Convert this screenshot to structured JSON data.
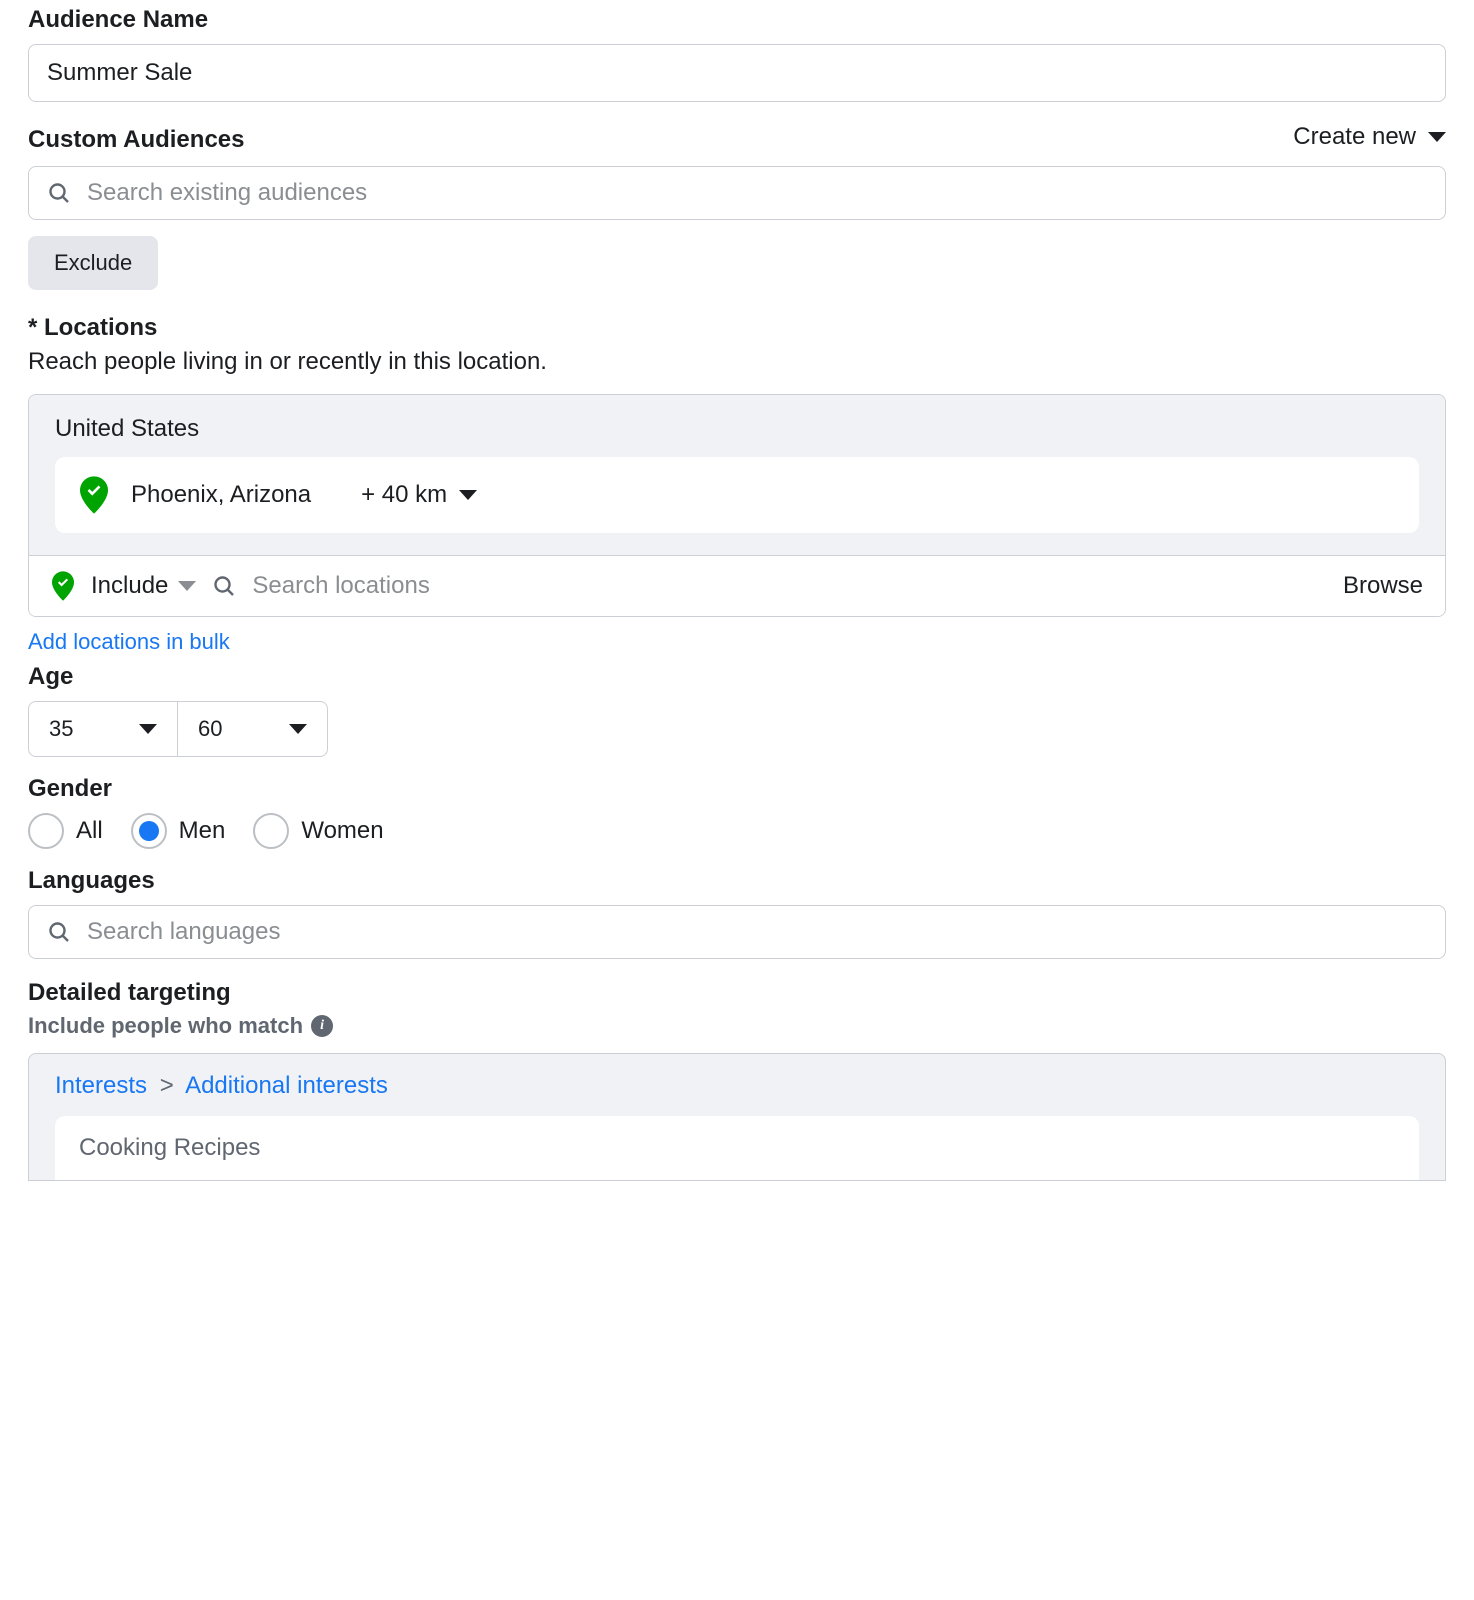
{
  "audienceName": {
    "label": "Audience Name",
    "value": "Summer Sale"
  },
  "customAudiences": {
    "label": "Custom Audiences",
    "createNew": "Create new",
    "searchPlaceholder": "Search existing audiences",
    "excludeLabel": "Exclude"
  },
  "locations": {
    "label": "* Locations",
    "description": "Reach people living in or recently in this location.",
    "country": "United States",
    "selected": {
      "name": "Phoenix, Arizona",
      "radius": "+ 40 km"
    },
    "includeLabel": "Include",
    "searchPlaceholder": "Search locations",
    "browseLabel": "Browse",
    "bulkLink": "Add locations in bulk"
  },
  "age": {
    "label": "Age",
    "min": "35",
    "max": "60"
  },
  "gender": {
    "label": "Gender",
    "options": {
      "all": "All",
      "men": "Men",
      "women": "Women"
    },
    "selected": "men"
  },
  "languages": {
    "label": "Languages",
    "placeholder": "Search languages"
  },
  "detailedTargeting": {
    "label": "Detailed targeting",
    "subLabel": "Include people who match",
    "breadcrumb": {
      "root": "Interests",
      "leaf": "Additional interests"
    },
    "item": "Cooking Recipes"
  }
}
